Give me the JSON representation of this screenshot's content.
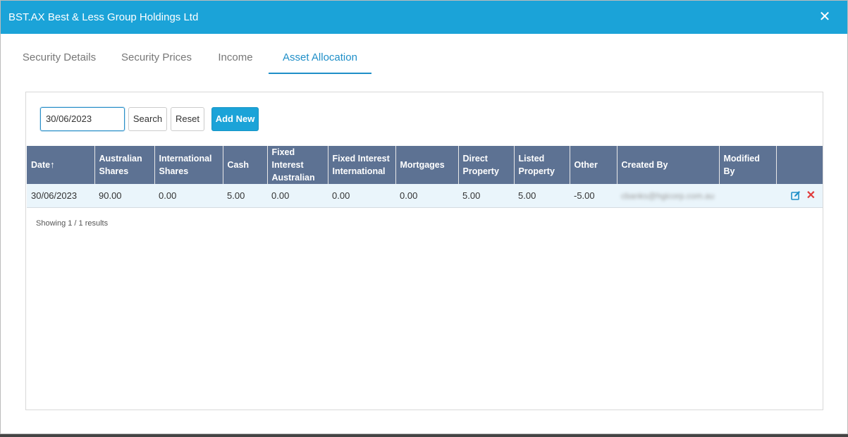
{
  "dialog": {
    "title": "BST.AX Best & Less Group Holdings Ltd",
    "close_glyph": "✕"
  },
  "tabs": [
    {
      "label": "Security Details",
      "active": false
    },
    {
      "label": "Security Prices",
      "active": false
    },
    {
      "label": "Income",
      "active": false
    },
    {
      "label": "Asset Allocation",
      "active": true
    }
  ],
  "toolbar": {
    "date_value": "30/06/2023",
    "search_label": "Search",
    "reset_label": "Reset",
    "add_new_label": "Add New"
  },
  "table": {
    "headers": [
      {
        "line1": "Date",
        "line2": "",
        "sort": "↑"
      },
      {
        "line1": "Australian",
        "line2": "Shares"
      },
      {
        "line1": "International",
        "line2": "Shares"
      },
      {
        "line1": "Cash",
        "line2": ""
      },
      {
        "line1": "Fixed Interest",
        "line2": "Australian"
      },
      {
        "line1": "Fixed Interest",
        "line2": "International"
      },
      {
        "line1": "Mortgages",
        "line2": ""
      },
      {
        "line1": "Direct",
        "line2": "Property"
      },
      {
        "line1": "Listed",
        "line2": "Property"
      },
      {
        "line1": "Other",
        "line2": ""
      },
      {
        "line1": "Created By",
        "line2": ""
      },
      {
        "line1": "Modified By",
        "line2": ""
      }
    ],
    "rows": [
      {
        "date": "30/06/2023",
        "australian_shares": "90.00",
        "international_shares": "0.00",
        "cash": "5.00",
        "fixed_interest_australian": "0.00",
        "fixed_interest_international": "0.00",
        "mortgages": "0.00",
        "direct_property": "5.00",
        "listed_property": "5.00",
        "other": "-5.00",
        "created_by": "cbanks@hgicorp.com.au",
        "modified_by": ""
      }
    ]
  },
  "results_text": "Showing 1 / 1 results",
  "colors": {
    "header_bar": "#1ba3d8",
    "table_header": "#5d7293",
    "active_tab": "#1f8fc8",
    "row_bg": "#eaf5fb",
    "delete": "#e03b3b"
  }
}
